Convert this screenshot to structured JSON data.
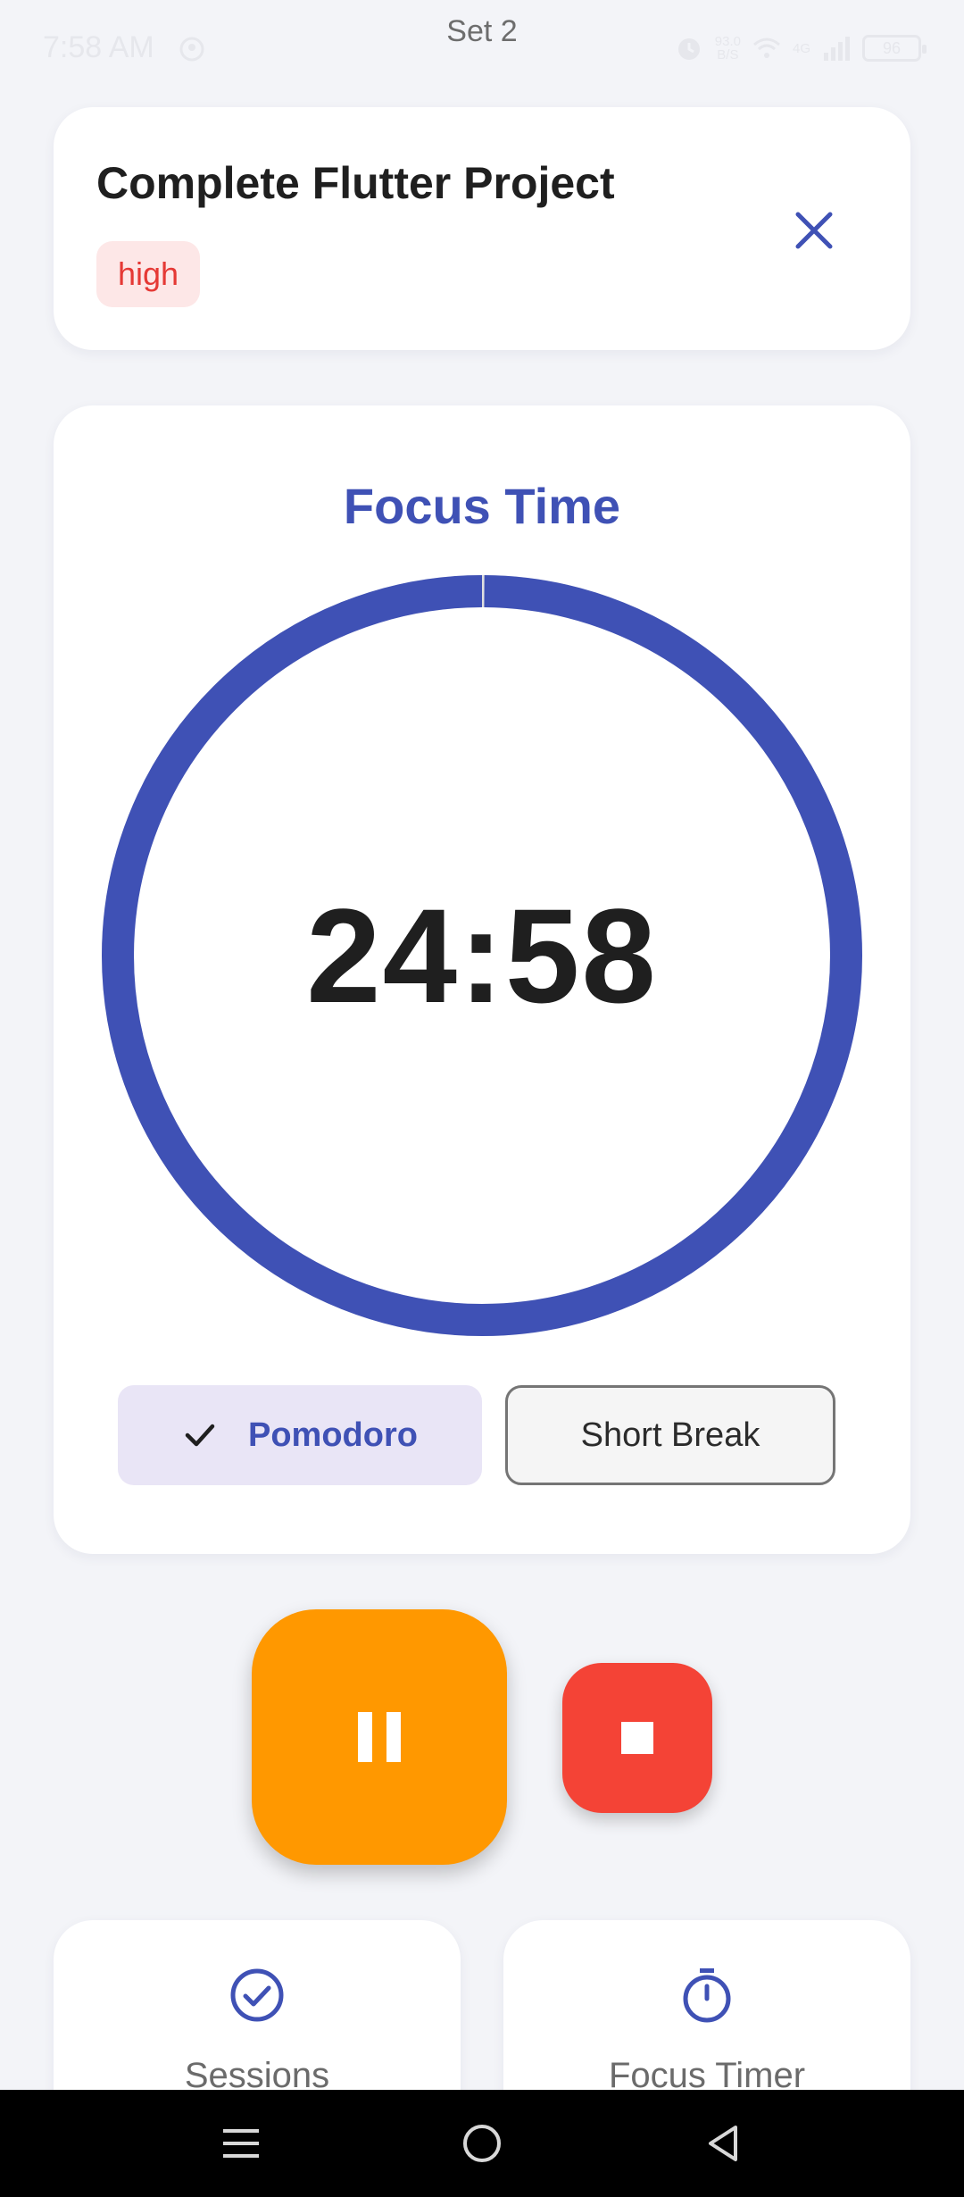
{
  "status_bar": {
    "time": "7:58 AM",
    "center_label": "Set 2",
    "net_speed_value": "93.0",
    "net_speed_unit": "B/S",
    "network_type": "4G",
    "battery": "96",
    "icons": [
      "app-notification-icon",
      "alarm-icon",
      "wifi-icon",
      "signal-icon",
      "battery-icon"
    ]
  },
  "task": {
    "title": "Complete Flutter Project",
    "priority": "high",
    "close_icon": "close-icon"
  },
  "timer": {
    "mode_title": "Focus Time",
    "time": "24:58",
    "progress_remaining_fraction": 0.999,
    "modes": [
      {
        "label": "Pomodoro",
        "selected": true
      },
      {
        "label": "Short Break",
        "selected": false
      }
    ]
  },
  "controls": {
    "pause_icon": "pause-icon",
    "stop_icon": "stop-icon"
  },
  "bottom_cards": [
    {
      "label": "Sessions",
      "icon": "check-circle-icon"
    },
    {
      "label": "Focus Timer",
      "icon": "timer-icon"
    }
  ],
  "colors": {
    "primary": "#3f51b5",
    "pause": "#ff9800",
    "stop": "#f44336",
    "priority_high_bg": "#fde7e7",
    "priority_high_text": "#e53935",
    "background": "#f3f4f8"
  },
  "nav_bar": {
    "icons": [
      "menu-icon",
      "home-icon",
      "back-icon"
    ]
  }
}
